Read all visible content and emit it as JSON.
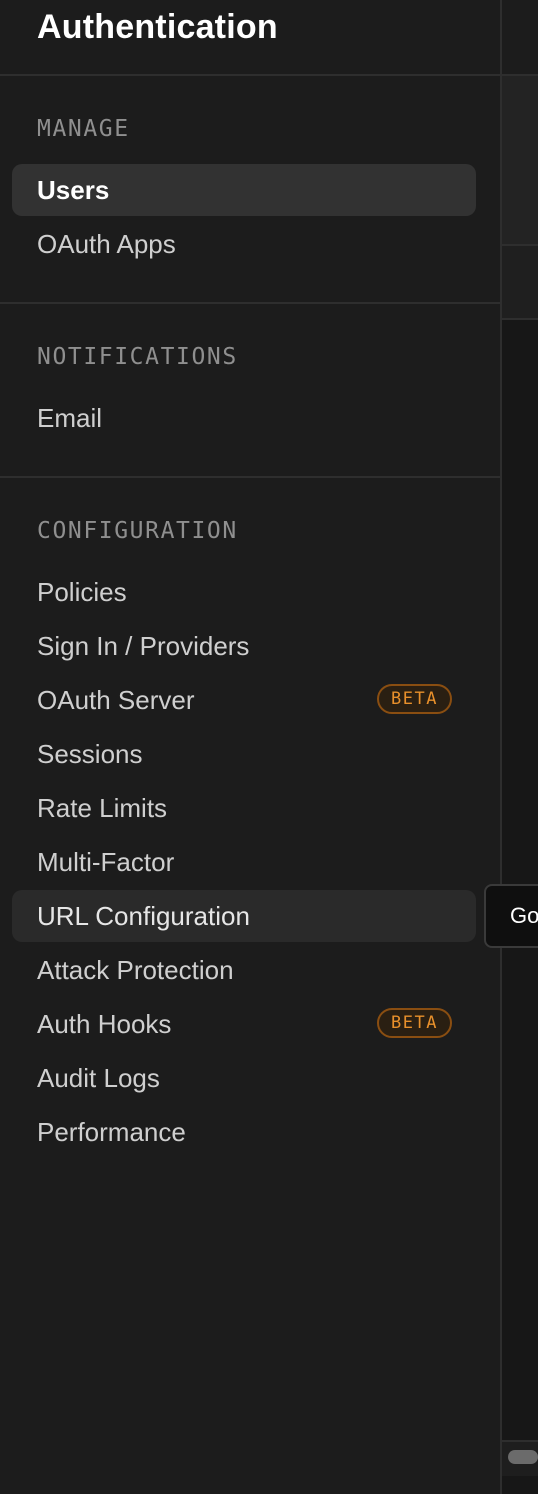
{
  "header": {
    "title": "Authentication"
  },
  "sections": {
    "manage": {
      "label": "MANAGE",
      "items": [
        "Users",
        "OAuth Apps"
      ]
    },
    "notifications": {
      "label": "NOTIFICATIONS",
      "items": [
        "Email"
      ]
    },
    "configuration": {
      "label": "CONFIGURATION",
      "items": [
        "Policies",
        "Sign In / Providers",
        "OAuth Server",
        "Sessions",
        "Rate Limits",
        "Multi-Factor",
        "URL Configuration",
        "Attack Protection",
        "Auth Hooks",
        "Audit Logs",
        "Performance"
      ]
    }
  },
  "badges": {
    "beta": "BETA"
  },
  "tooltip": {
    "text": "Go"
  },
  "colors": {
    "background": "#1c1c1c",
    "active_item": "#323232",
    "badge_text": "#e8902b",
    "badge_border": "#8a4e11"
  },
  "state": {
    "selected_item": "Users",
    "hovered_item": "URL Configuration"
  }
}
